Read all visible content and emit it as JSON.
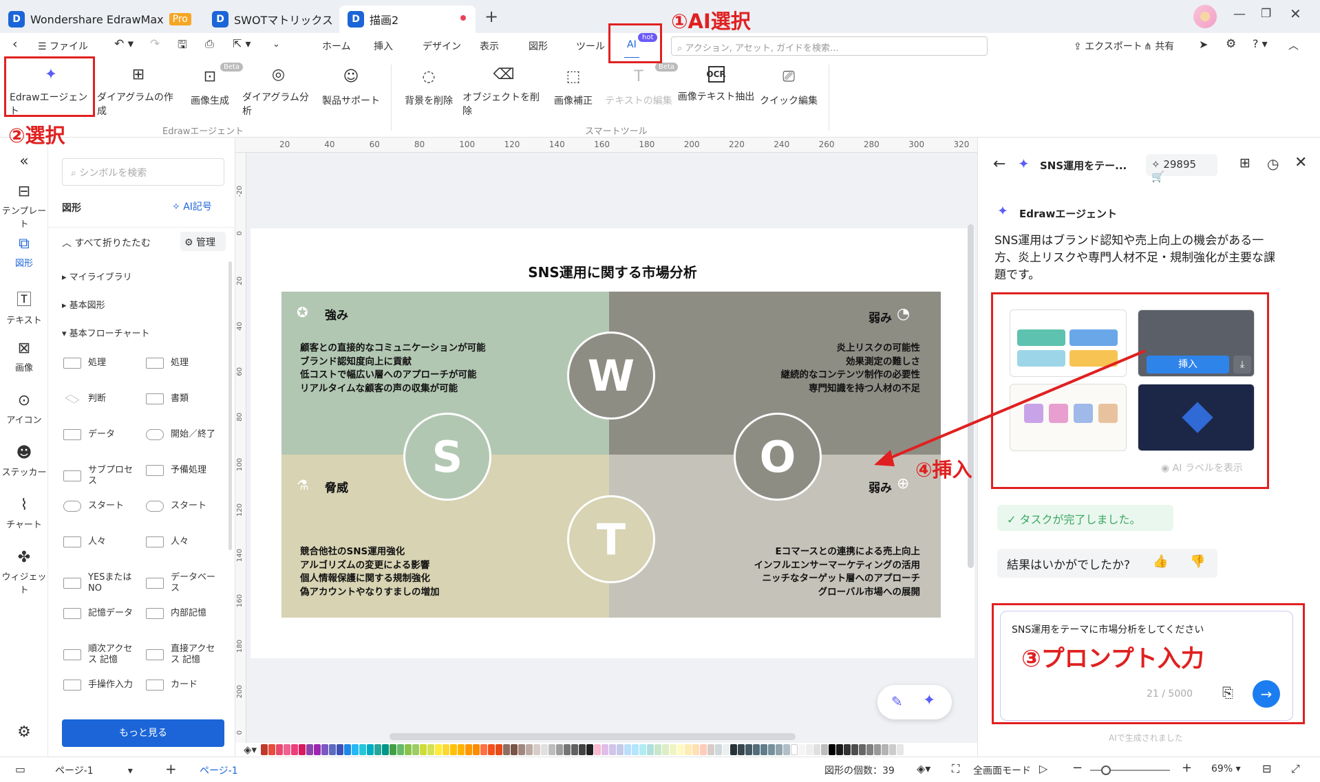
{
  "titlebar": {
    "app_name": "Wondershare EdrawMax",
    "pro_badge": "Pro",
    "tabs": [
      {
        "label": "SWOTマトリックス"
      },
      {
        "label": "描画2"
      }
    ],
    "add_tab": "+"
  },
  "menubar": {
    "file": "ファイル",
    "tabs": [
      "ホーム",
      "挿入",
      "デザイン",
      "表示",
      "図形",
      "ツール",
      "AI"
    ],
    "ai_hot": "hot",
    "search_placeholder": "アクション, アセット, ガイドを検索...",
    "export": "エクスポート",
    "share": "共有"
  },
  "ribbon": {
    "ai_tools": [
      {
        "label": "Edrawエージェント",
        "icon": "sparkle-icon"
      },
      {
        "label": "ダイアグラムの作成",
        "icon": "diagram-create-icon"
      },
      {
        "label": "画像生成",
        "icon": "image-gen-icon",
        "badge": "Beta"
      },
      {
        "label": "ダイアグラム分析",
        "icon": "analysis-icon"
      },
      {
        "label": "製品サポート",
        "icon": "support-icon"
      }
    ],
    "group1": "Edrawエージェント",
    "smart_tools": [
      {
        "label": "背景を削除",
        "icon": "remove-bg-icon"
      },
      {
        "label": "オブジェクトを削除",
        "icon": "eraser-icon"
      },
      {
        "label": "画像補正",
        "icon": "enhance-icon"
      },
      {
        "label": "テキストの編集",
        "icon": "text-edit-icon",
        "badge": "Beta",
        "disabled": true
      },
      {
        "label": "画像テキスト抽出",
        "icon": "ocr-icon"
      },
      {
        "label": "クイック編集",
        "icon": "quick-edit-icon"
      }
    ],
    "group2": "スマートツール"
  },
  "leftnav": {
    "collapse": "«",
    "items": [
      {
        "label": "テンプレート",
        "icon": "template-icon"
      },
      {
        "label": "図形",
        "icon": "shapes-icon",
        "active": true
      },
      {
        "label": "テキスト",
        "icon": "text-icon"
      },
      {
        "label": "画像",
        "icon": "image-icon"
      },
      {
        "label": "アイコン",
        "icon": "icon-icon"
      },
      {
        "label": "ステッカー",
        "icon": "sticker-icon"
      },
      {
        "label": "チャート",
        "icon": "chart-icon"
      },
      {
        "label": "ウィジェット",
        "icon": "widget-icon"
      }
    ]
  },
  "symbols": {
    "search_placeholder": "シンボルを検索",
    "title": "図形",
    "ai_symbol": "AI記号",
    "collapse_all": "すべて折りたたむ",
    "manage": "管理",
    "libraries": [
      "マイライブラリ",
      "基本図形",
      "基本フローチャート"
    ],
    "shapes": [
      [
        "処理",
        "処理"
      ],
      [
        "判断",
        "書類"
      ],
      [
        "データ",
        "開始／終了"
      ],
      [
        "サブプロセス",
        "予備処理"
      ],
      [
        "スタート",
        "スタート"
      ],
      [
        "人々",
        "人々"
      ],
      [
        "YESまたは NO",
        "データベース"
      ],
      [
        "記憶データ",
        "内部記憶"
      ],
      [
        "順次アクセス 記憶",
        "直接アクセス 記憶"
      ],
      [
        "手操作入力",
        "カード"
      ]
    ],
    "more": "もっと見る"
  },
  "ruler": {
    "top": [
      "20",
      "40",
      "60",
      "80",
      "100",
      "120",
      "140",
      "160",
      "180",
      "200",
      "220",
      "240",
      "260",
      "280",
      "300",
      "320"
    ],
    "left": [
      "-20",
      "0",
      "20",
      "40",
      "60",
      "80",
      "100",
      "120",
      "140",
      "160",
      "180",
      "200",
      "0"
    ]
  },
  "swot": {
    "title": "SNS運用に関する市場分析",
    "strength": {
      "heading": "強み",
      "letter": "S",
      "items": [
        "顧客との直接的なコミュニケーションが可能",
        "ブランド認知度向上に貢献",
        "低コストで幅広い層へのアプローチが可能",
        "リアルタイムな顧客の声の収集が可能"
      ]
    },
    "weakness": {
      "heading": "弱み",
      "letter": "W",
      "items": [
        "炎上リスクの可能性",
        "効果測定の難しさ",
        "継続的なコンテンツ制作の必要性",
        "専門知識を持つ人材の不足"
      ]
    },
    "threat": {
      "heading": "脅威",
      "letter": "T",
      "items": [
        "競合他社のSNS運用強化",
        "アルゴリズムの変更による影響",
        "個人情報保護に関する規制強化",
        "偽アカウントやなりすましの増加"
      ]
    },
    "opportunity": {
      "heading": "弱み",
      "letter": "O",
      "items": [
        "Eコマースとの連携による売上向上",
        "インフルエンサーマーケティングの活用",
        "ニッチなターゲット層へのアプローチ",
        "グローバル市場への展開"
      ]
    }
  },
  "agent": {
    "header_title": "SNS運用をテー...",
    "credits": "29895",
    "agent_name": "Edrawエージェント",
    "message": "SNS運用はブランド認知や売上向上の機会がある一方、炎上リスクや専門人材不足・規制強化が主要な課題です。",
    "insert": "挿入",
    "show_ai_label": "AI ラベルを表示",
    "task_done": "タスクが完了しました。",
    "feedback": "結果はいかがでしたか?",
    "prompt_text": "SNS運用をテーマに市場分析をしてください",
    "counter": "21 / 5000",
    "footer": "AIで生成されました"
  },
  "annotations": {
    "a1": "①AI選択",
    "a2": "②選択",
    "a3": "③プロンプト入力",
    "a4": "④挿入"
  },
  "statusbar": {
    "page_select": "ページ-1",
    "page_tab": "ページ-1",
    "shape_count_label": "図形の個数：",
    "shape_count": "39",
    "fullscreen": "全画面モード",
    "zoom": "69%"
  },
  "colors": {
    "strength": "#b2c7b2",
    "weakness": "#8e8d84",
    "threat": "#d7d3b3",
    "opportunity": "#c5c3b9",
    "accent": "#1b65d8",
    "annotation": "#e02020"
  }
}
